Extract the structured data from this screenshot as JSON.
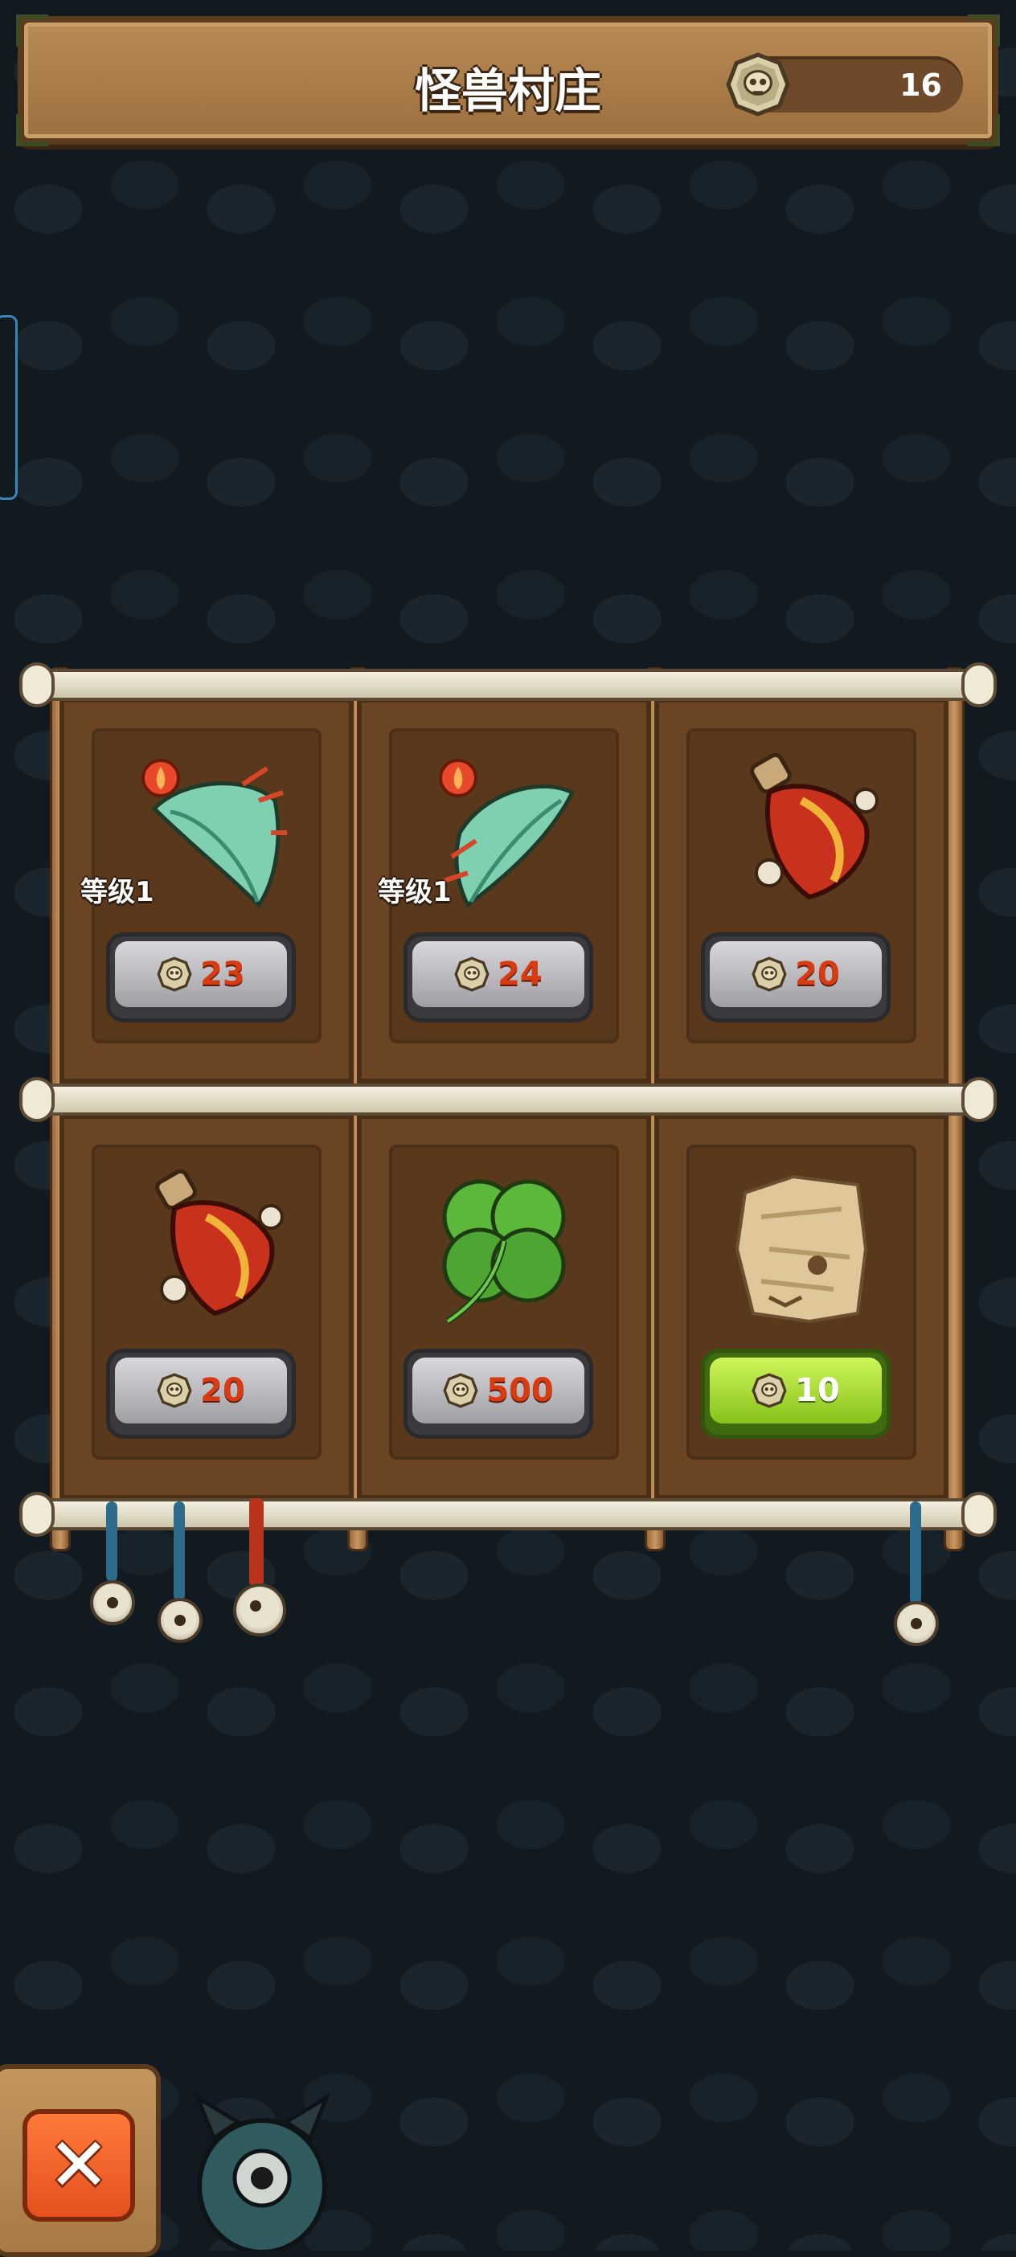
{
  "header": {
    "title": "怪兽村庄",
    "coin_count": "16",
    "coin_icon": "skull-coin-icon"
  },
  "shop": {
    "items": [
      {
        "name": "fire-wing",
        "level_label": "等级1",
        "price": "23",
        "button": "gray"
      },
      {
        "name": "fire-wing",
        "level_label": "等级1",
        "price": "24",
        "button": "gray"
      },
      {
        "name": "heart-potion",
        "level_label": "",
        "price": "20",
        "button": "gray"
      },
      {
        "name": "heart-potion",
        "level_label": "",
        "price": "20",
        "button": "gray"
      },
      {
        "name": "four-leaf-clover",
        "level_label": "",
        "price": "500",
        "button": "gray"
      },
      {
        "name": "treasure-map",
        "level_label": "",
        "price": "10",
        "button": "green"
      }
    ]
  },
  "footer": {
    "close_icon": "close-x-icon",
    "monster_icon": "monster-head-icon"
  },
  "colors": {
    "background": "#121b22",
    "wood": "#b88a54",
    "price_text": "#d83a12",
    "buy_green": "#86c21a",
    "close_orange": "#e4501e"
  }
}
